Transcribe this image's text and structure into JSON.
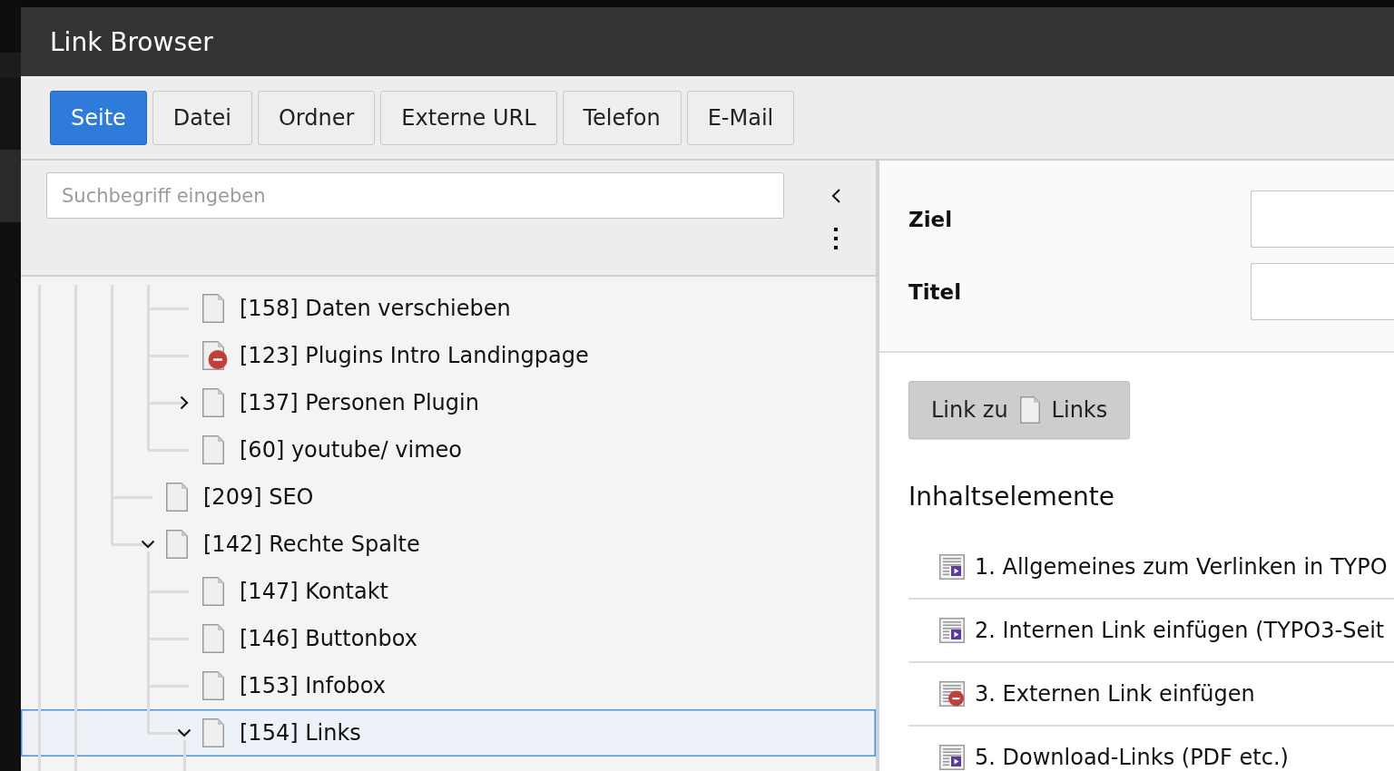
{
  "window": {
    "title": "Link Browser"
  },
  "tabs": [
    {
      "label": "Seite",
      "selected": true
    },
    {
      "label": "Datei",
      "selected": false
    },
    {
      "label": "Ordner",
      "selected": false
    },
    {
      "label": "Externe URL",
      "selected": false
    },
    {
      "label": "Telefon",
      "selected": false
    },
    {
      "label": "E-Mail",
      "selected": false
    }
  ],
  "page_tree": {
    "search": {
      "placeholder": "Suchbegriff eingeben"
    },
    "items": [
      {
        "children": [
          {
            "label": "[158] Daten verschieben",
            "hidden": false,
            "selected": false
          },
          {
            "label": "[123] Plugins Intro Landingpage",
            "hidden": true,
            "selected": false
          },
          {
            "label": "[137] Personen Plugin",
            "hidden": false,
            "selected": false,
            "expanded": false
          },
          {
            "label": "[60] youtube/ vimeo",
            "hidden": false,
            "selected": false
          }
        ]
      },
      {
        "label": "[209] SEO",
        "hidden": false,
        "selected": false
      },
      {
        "label": "[142] Rechte Spalte",
        "hidden": false,
        "selected": false,
        "expanded": true,
        "children": [
          {
            "label": "[147] Kontakt",
            "hidden": false,
            "selected": false
          },
          {
            "label": "[146] Buttonbox",
            "hidden": false,
            "selected": false
          },
          {
            "label": "[153] Infobox",
            "hidden": false,
            "selected": false
          },
          {
            "label": "[154] Links",
            "hidden": false,
            "selected": true,
            "expanded": true
          }
        ]
      }
    ]
  },
  "link_form": {
    "fields": [
      {
        "label": "Ziel"
      },
      {
        "label": "Titel"
      }
    ]
  },
  "link_button": {
    "prefix": "Link zu",
    "target": "Links"
  },
  "content_elements": {
    "heading": "Inhaltselemente",
    "items": [
      {
        "label": "1. Allgemeines zum Verlinken in TYPO",
        "hidden": false
      },
      {
        "label": "2. Internen Link einfügen (TYPO3-Seit",
        "hidden": false
      },
      {
        "label": "3. Externen Link einfügen",
        "hidden": true
      },
      {
        "label": "5. Download-Links (PDF etc.)",
        "hidden": false
      }
    ]
  }
}
